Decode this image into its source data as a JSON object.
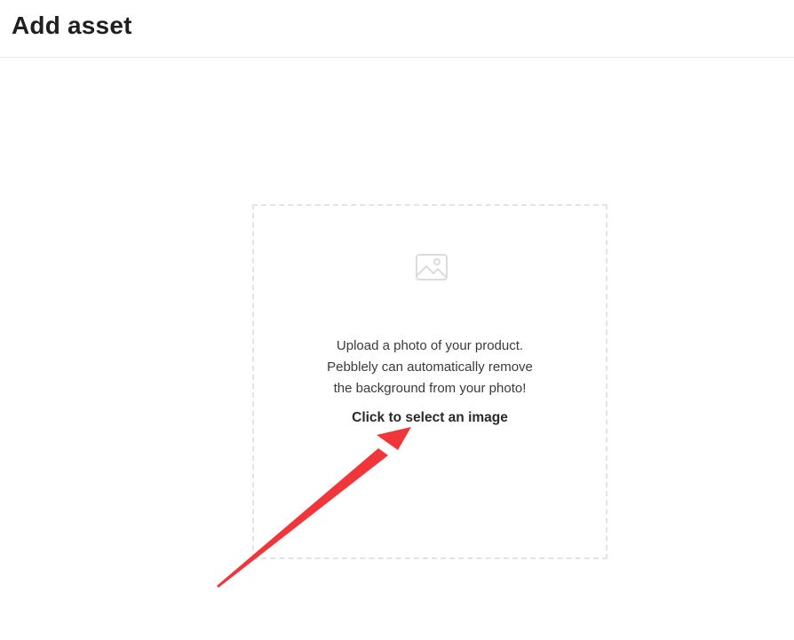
{
  "header": {
    "title": "Add asset"
  },
  "dropzone": {
    "icon": "image-icon",
    "lines": [
      "Upload a photo of your product.",
      "Pebblely can automatically remove",
      "the background from your photo!"
    ],
    "cta_label": "Click to select an image"
  },
  "annotation": {
    "color": "#f0353b"
  }
}
